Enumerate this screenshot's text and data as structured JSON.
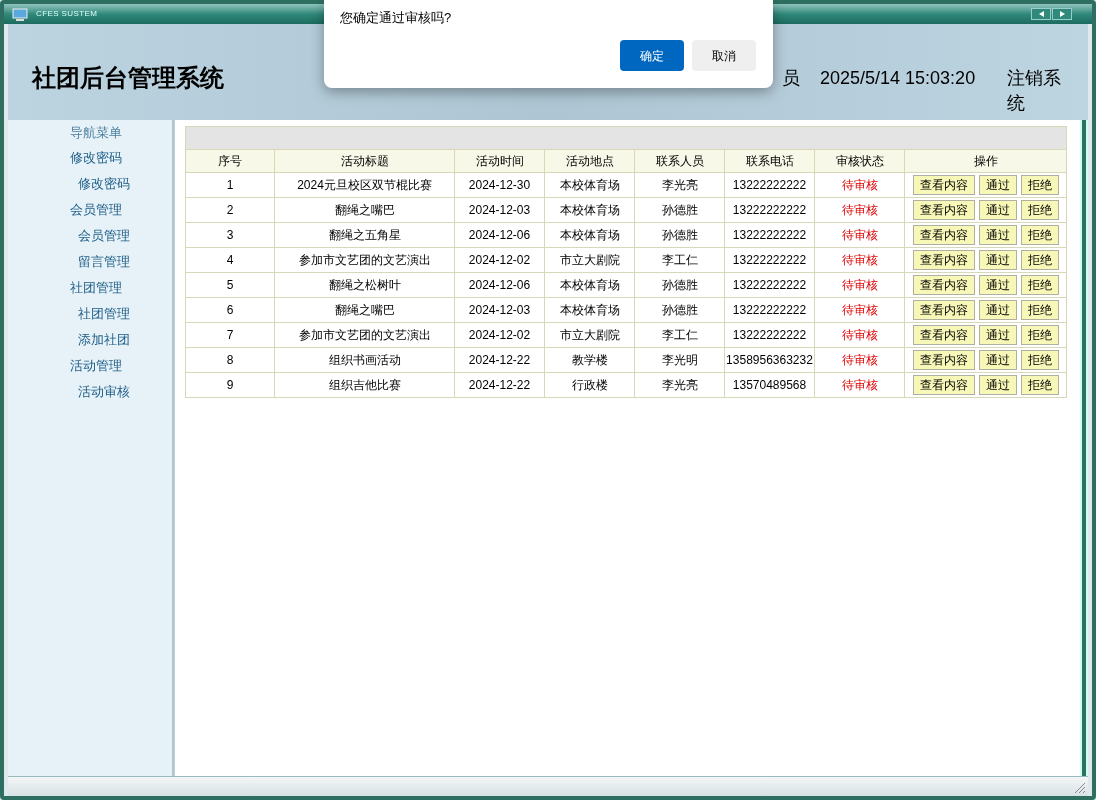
{
  "window": {
    "title": "CFES SUSTEM"
  },
  "header": {
    "title": "社团后台管理系统",
    "user": "员",
    "datetime": "2025/5/14 15:03:20",
    "logout": "注销系统"
  },
  "dialog": {
    "message": "您确定通过审核吗?",
    "buttons": [
      {
        "label": "确定",
        "kind": "primary"
      },
      {
        "label": "取消",
        "kind": "secondary"
      }
    ]
  },
  "sidebar": {
    "heading": "导航菜单",
    "groups": [
      {
        "label": "修改密码",
        "children": [
          {
            "label": "修改密码"
          }
        ]
      },
      {
        "label": "会员管理",
        "children": [
          {
            "label": "会员管理"
          },
          {
            "label": "留言管理"
          }
        ]
      },
      {
        "label": "社团管理",
        "children": [
          {
            "label": "社团管理"
          },
          {
            "label": "添加社团"
          }
        ]
      },
      {
        "label": "活动管理",
        "children": [
          {
            "label": "活动审核"
          }
        ]
      }
    ]
  },
  "table": {
    "columns": [
      "序号",
      "活动标题",
      "活动时间",
      "活动地点",
      "联系人员",
      "联系电话",
      "审核状态",
      "操作"
    ],
    "rows": [
      {
        "cells": [
          "1",
          "2024元旦校区双节棍比赛",
          "2024-12-30",
          "本校体育场",
          "李光亮",
          "13222222222",
          "待审核"
        ],
        "actions": [
          "查看内容",
          "通过",
          "拒绝"
        ]
      },
      {
        "cells": [
          "2",
          "翻绳之嘴巴",
          "2024-12-03",
          "本校体育场",
          "孙德胜",
          "13222222222",
          "待审核"
        ],
        "actions": [
          "查看内容",
          "通过",
          "拒绝"
        ]
      },
      {
        "cells": [
          "3",
          "翻绳之五角星",
          "2024-12-06",
          "本校体育场",
          "孙德胜",
          "13222222222",
          "待审核"
        ],
        "actions": [
          "查看内容",
          "通过",
          "拒绝"
        ]
      },
      {
        "cells": [
          "4",
          "参加市文艺团的文艺演出",
          "2024-12-02",
          "市立大剧院",
          "李工仁",
          "13222222222",
          "待审核"
        ],
        "actions": [
          "查看内容",
          "通过",
          "拒绝"
        ]
      },
      {
        "cells": [
          "5",
          "翻绳之松树叶",
          "2024-12-06",
          "本校体育场",
          "孙德胜",
          "13222222222",
          "待审核"
        ],
        "actions": [
          "查看内容",
          "通过",
          "拒绝"
        ]
      },
      {
        "cells": [
          "6",
          "翻绳之嘴巴",
          "2024-12-03",
          "本校体育场",
          "孙德胜",
          "13222222222",
          "待审核"
        ],
        "actions": [
          "查看内容",
          "通过",
          "拒绝"
        ]
      },
      {
        "cells": [
          "7",
          "参加市文艺团的文艺演出",
          "2024-12-02",
          "市立大剧院",
          "李工仁",
          "13222222222",
          "待审核"
        ],
        "actions": [
          "查看内容",
          "通过",
          "拒绝"
        ]
      },
      {
        "cells": [
          "8",
          "组织书画活动",
          "2024-12-22",
          "教学楼",
          "李光明",
          "1358956363232",
          "待审核"
        ],
        "actions": [
          "查看内容",
          "通过",
          "拒绝"
        ]
      },
      {
        "cells": [
          "9",
          "组织吉他比赛",
          "2024-12-22",
          "行政楼",
          "李光亮",
          "13570489568",
          "待审核"
        ],
        "actions": [
          "查看内容",
          "通过",
          "拒绝"
        ]
      }
    ]
  }
}
